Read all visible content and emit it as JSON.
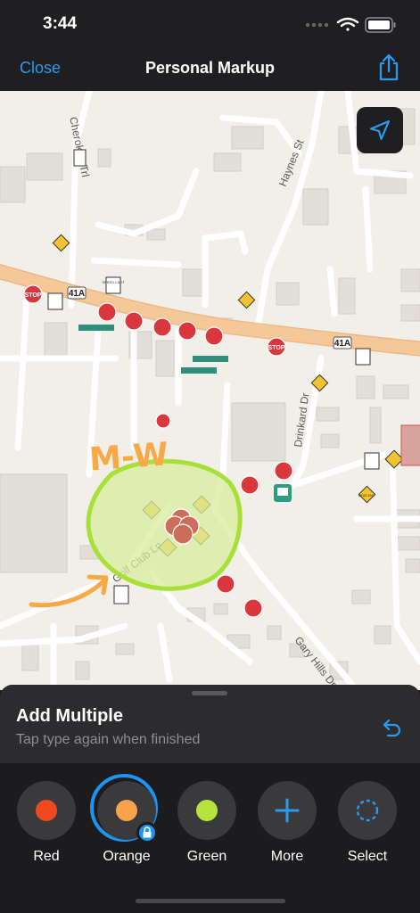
{
  "status_bar": {
    "time": "3:44"
  },
  "nav": {
    "close_label": "Close",
    "title": "Personal Markup"
  },
  "map": {
    "streets": [
      "Cherokee Trl",
      "Haynes St",
      "Drinkard Dr",
      "Golf Club Ln",
      "Gary Hills Dr"
    ],
    "route_labels": [
      "41A",
      "41A"
    ],
    "stop_label": "STOP",
    "speed_limit_label": "SPEED LIMIT",
    "dead_end_label": "DEAD END",
    "annotation_text": "M-W"
  },
  "sheet": {
    "title": "Add Multiple",
    "subtitle": "Tap type again when finished"
  },
  "tools": [
    {
      "label": "Red",
      "color": "#ef4a1f"
    },
    {
      "label": "Orange",
      "color": "#f6a34c"
    },
    {
      "label": "Green",
      "color": "#b6e33d"
    },
    {
      "label": "More",
      "color": "#2b9bf0"
    },
    {
      "label": "Select",
      "color": "#2b9bf0"
    }
  ],
  "colors": {
    "accent": "#2b9bf0",
    "major_road": "#f6c898",
    "stop_sign": "#d9363e",
    "markup_green": "#a8e03a",
    "markup_orange": "#f6a945"
  }
}
